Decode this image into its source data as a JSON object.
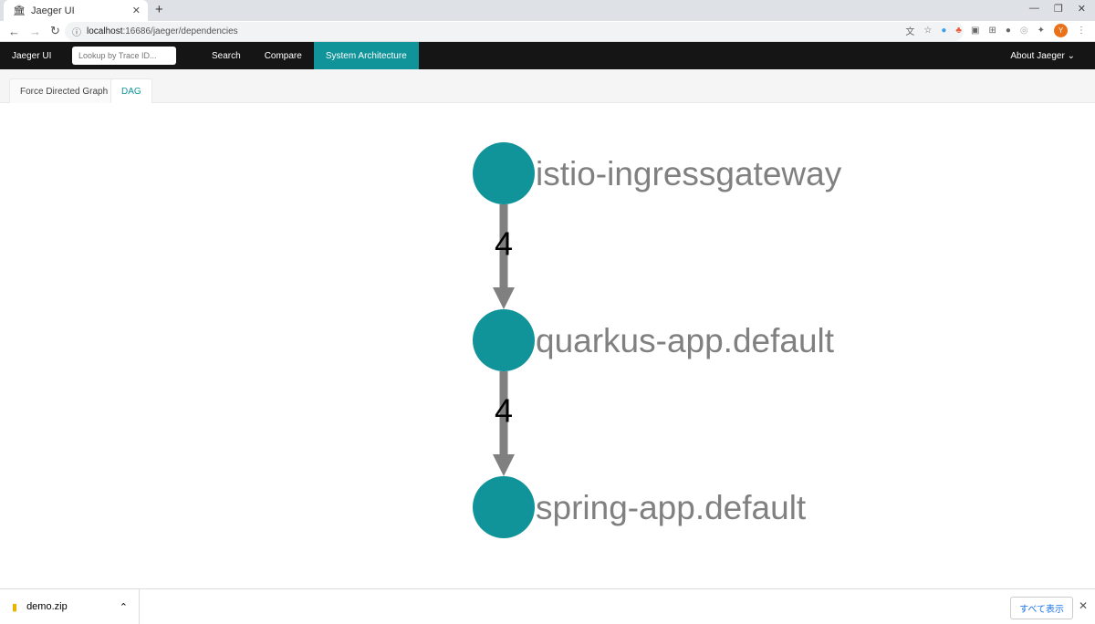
{
  "browser": {
    "tab_title": "Jaeger UI",
    "url_host": "localhost",
    "url_rest": ":16686/jaeger/dependencies",
    "avatar_letter": "Y"
  },
  "topnav": {
    "brand": "Jaeger UI",
    "search_placeholder": "Lookup by Trace ID...",
    "items": [
      "Search",
      "Compare",
      "System Architecture"
    ],
    "active": "System Architecture",
    "about": "About Jaeger"
  },
  "subtabs": {
    "items": [
      "Force Directed Graph",
      "DAG"
    ],
    "active": "DAG"
  },
  "graph": {
    "node_color": "#11939a",
    "edge_color": "#808080",
    "nodes": [
      "istio-ingressgateway",
      "quarkus-app.default",
      "spring-app.default"
    ],
    "edges": [
      {
        "from": "istio-ingressgateway",
        "to": "quarkus-app.default",
        "label": "4"
      },
      {
        "from": "quarkus-app.default",
        "to": "spring-app.default",
        "label": "4"
      }
    ]
  },
  "downloads": {
    "file": "demo.zip",
    "show_all": "すべて表示"
  }
}
